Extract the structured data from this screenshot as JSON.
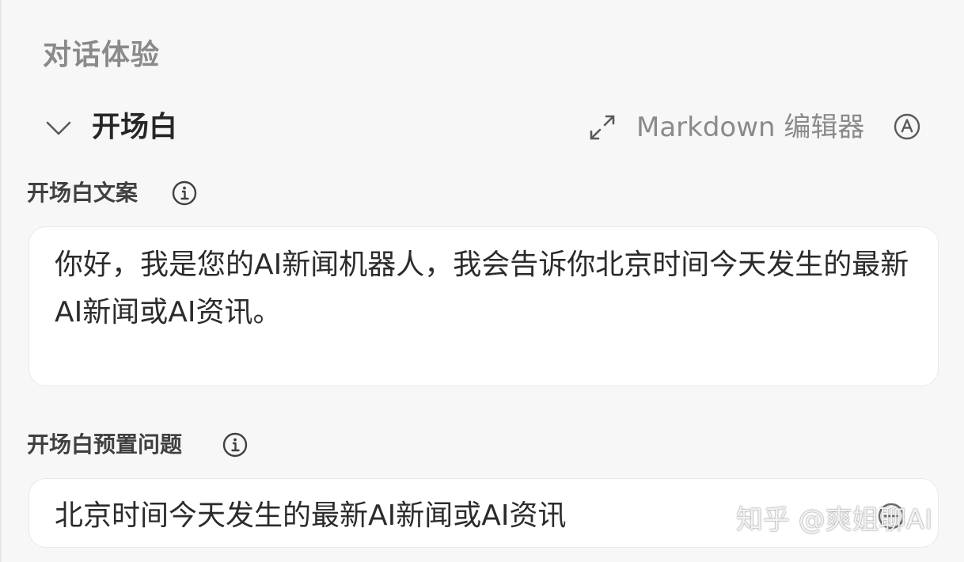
{
  "section": {
    "title": "对话体验"
  },
  "panel": {
    "title": "开场白",
    "markdown_editor_label": "Markdown 编辑器",
    "icons": {
      "collapse": "chevron-down-icon",
      "expand": "expand-icon",
      "markdown_toggle": "circle-a-icon"
    }
  },
  "greeting": {
    "label": "开场白文案",
    "info_icon": "info-icon",
    "value": "你好，我是您的AI新闻机器人，我会告诉你北京时间今天发生的最新AI新闻或AI资讯。"
  },
  "preset_questions": {
    "label": "开场白预置问题",
    "info_icon": "info-icon",
    "items": [
      "北京时间今天发生的最新AI新闻或AI资讯"
    ]
  },
  "watermark": {
    "text": "知乎 @爽姐聊AI"
  },
  "colors": {
    "background": "#f7f7f7",
    "box_background": "#ffffff",
    "muted_text": "#8a8a8a",
    "title_text": "#262626"
  }
}
